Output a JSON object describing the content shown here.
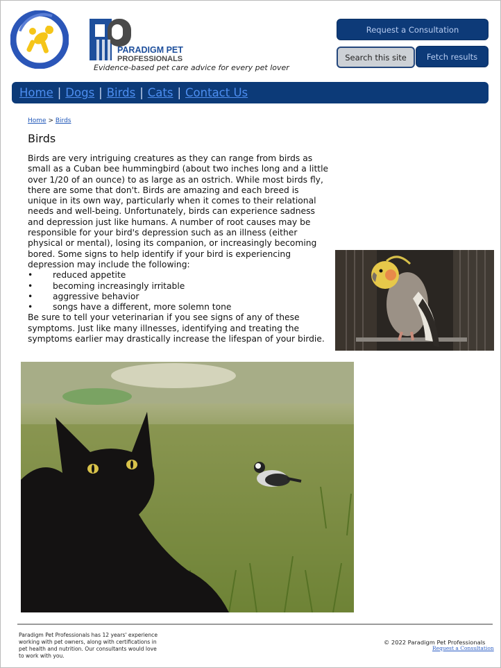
{
  "header": {
    "brand_line1": "PARADIGM PET",
    "brand_line2": "PROFESSIONALS",
    "tagline": "Evidence-based pet care advice for every pet lover",
    "consult_button": "Request a Consultation",
    "search_button": "Search this site",
    "fetch_button": "Fetch results"
  },
  "nav": {
    "items": [
      {
        "label": "Home"
      },
      {
        "label": "Dogs"
      },
      {
        "label": "Birds"
      },
      {
        "label": "Cats"
      },
      {
        "label": "Contact Us"
      }
    ],
    "separator": "|"
  },
  "breadcrumb": {
    "home": "Home",
    "sep": ">",
    "current": "Birds"
  },
  "page": {
    "title": "Birds",
    "intro": "Birds are very intriguing creatures as they can range from birds as small as a Cuban bee hummingbird (about two inches long and a little over 1/20 of an ounce) to as large as an ostrich. While most birds fly, there are some that don't. Birds are amazing and each breed is unique in its own way, particularly when it comes to their relational needs and well-being. Unfortunately, birds can experience sadness and depression just like humans. A number of root causes may be responsible for your bird's depression such as an illness (either physical or mental), losing its companion, or increasingly becoming bored. Some signs to help identify if your bird is experiencing depression may include the following:",
    "signs": [
      "reduced appetite",
      "becoming increasingly irritable",
      "aggressive behavior",
      "songs have a different, more solemn tone"
    ],
    "bullet": "•",
    "outro": "Be sure to tell your veterinarian if you see signs of any of these symptoms. Just like many illnesses, identifying and treating the symptoms earlier may drastically increase the lifespan of your birdie."
  },
  "footer": {
    "about": "Paradigm Pet Professionals has 12 years' experience working with pet owners, along with certifications in pet health and nutrition. Our consultants would love to work with you.",
    "copyright": "© 2022 Paradigm Pet Professionals",
    "link": "Request a Consultation"
  },
  "colors": {
    "navy": "#0c3a78",
    "logo_blue": "#2b56b8",
    "logo_yellow": "#f5c518"
  }
}
